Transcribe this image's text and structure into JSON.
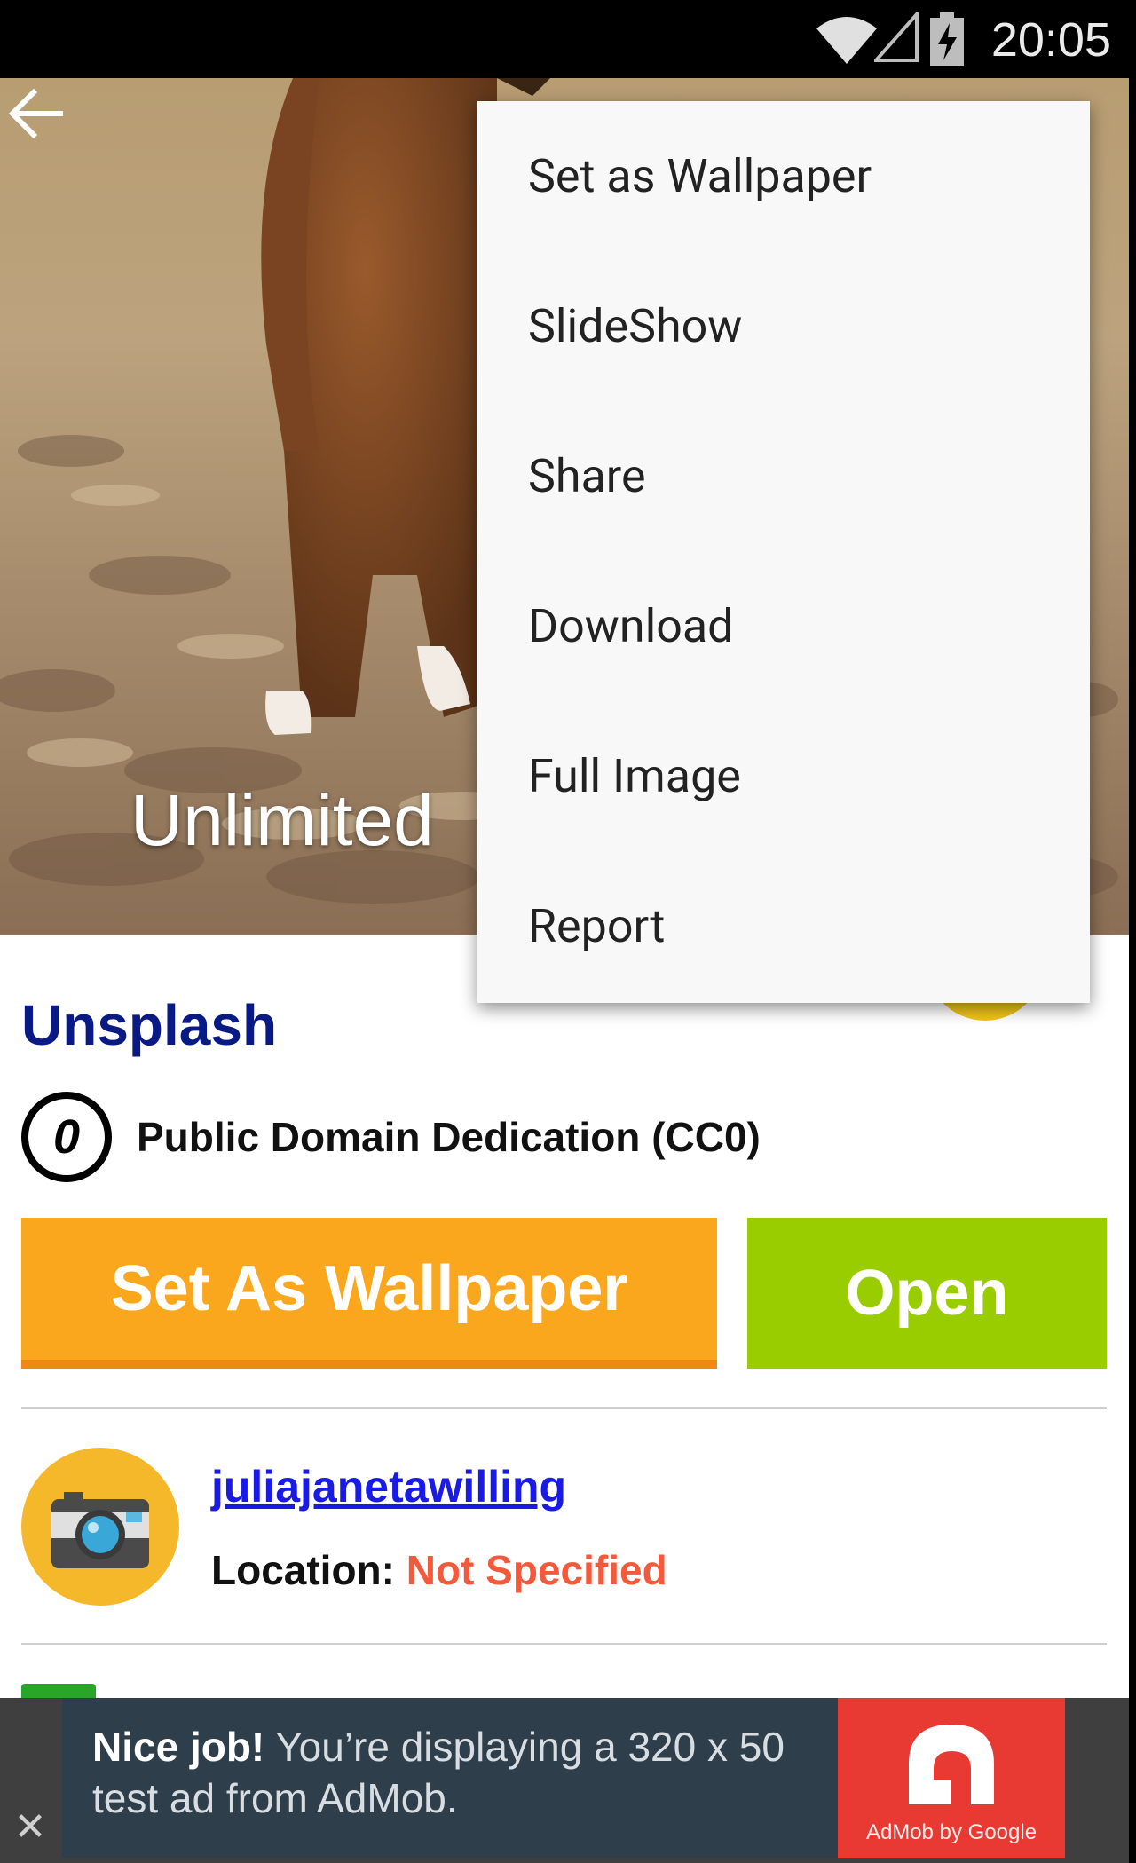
{
  "status_bar": {
    "time": "20:05"
  },
  "hero": {
    "overlay_title": "Unlimited"
  },
  "menu": {
    "items": [
      {
        "label": "Set as Wallpaper"
      },
      {
        "label": "SlideShow"
      },
      {
        "label": "Share"
      },
      {
        "label": "Download"
      },
      {
        "label": "Full Image"
      },
      {
        "label": "Report"
      }
    ]
  },
  "content": {
    "source_title": "Unsplash",
    "license_icon_glyph": "0",
    "license": "Public Domain Dedication (CC0)",
    "set_wallpaper_label": "Set As Wallpaper",
    "open_label": "Open",
    "author": "juliajanetawilling",
    "location_label": "Location:",
    "location_value": "Not Specified"
  },
  "ad": {
    "bold_text": "Nice job!",
    "line1_rest": " You’re displaying a 320 x 50",
    "line2": "test ad from AdMob.",
    "brand": "AdMob by Google",
    "close_glyph": "✕"
  },
  "colors": {
    "title_blue": "#0a1a85",
    "wallpaper_button": "#fba71e",
    "open_button": "#9acd00",
    "link": "#1a1ae6",
    "location_value": "#f35a3b",
    "ad_logo": "#e83a33"
  }
}
